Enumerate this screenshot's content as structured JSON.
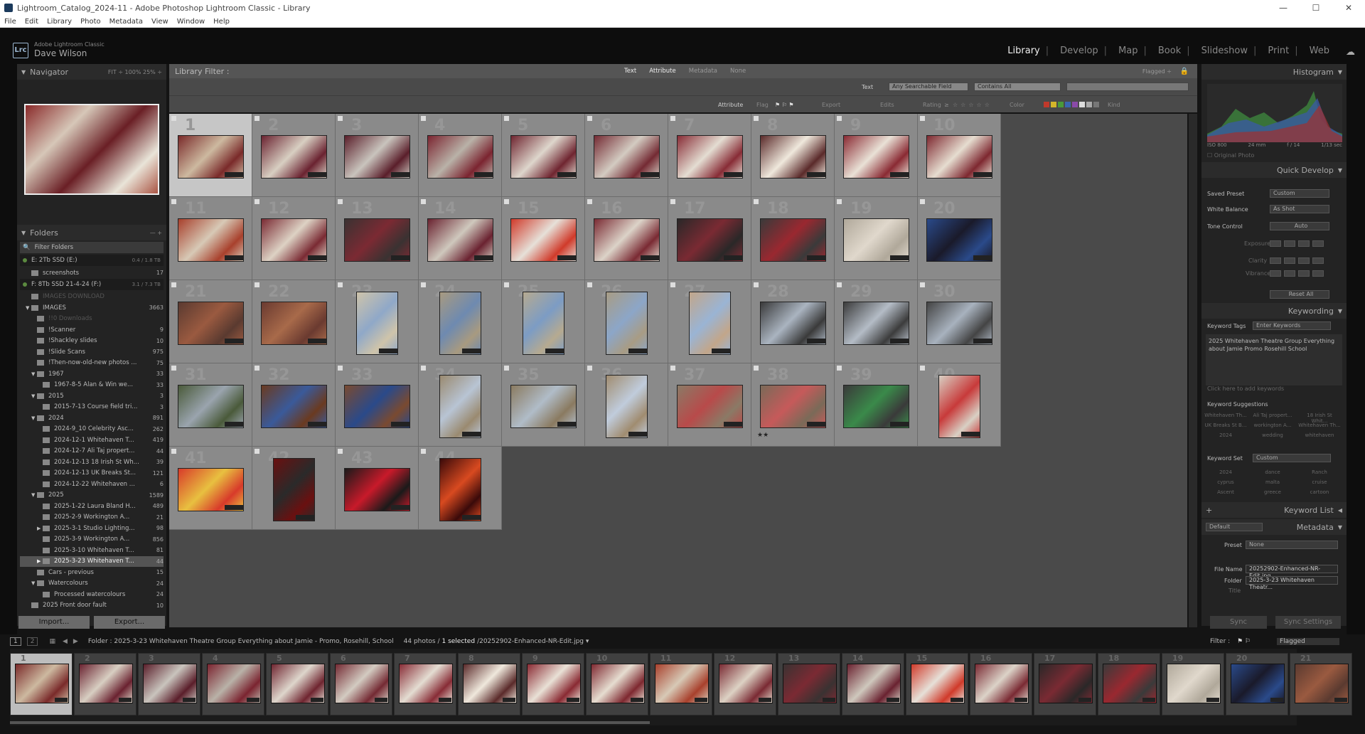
{
  "window": {
    "title": "Lightroom_Catalog_2024-11 - Adobe Photoshop Lightroom Classic - Library",
    "minimize": "—",
    "maximize": "☐",
    "close": "✕"
  },
  "menu": [
    "File",
    "Edit",
    "Library",
    "Photo",
    "Metadata",
    "View",
    "Window",
    "Help"
  ],
  "identity": {
    "logo": "Lrc",
    "product": "Adobe Lightroom Classic",
    "user": "Dave Wilson"
  },
  "modules": [
    "Library",
    "Develop",
    "Map",
    "Book",
    "Slideshow",
    "Print",
    "Web"
  ],
  "active_module": "Library",
  "navigator": {
    "title": "Navigator",
    "zoom": "FIT ÷   100%   25% ÷"
  },
  "folders": {
    "title": "Folders",
    "filter_placeholder": "Filter Folders",
    "drives": [
      {
        "name": "E: 2Tb SSD (E:)",
        "size": "0.4 / 1.8 TB"
      },
      {
        "name": "F: 8Tb SSD 21-4-24 (F:)",
        "size": "3.1 / 7.3 TB"
      }
    ],
    "items": [
      {
        "name": "screenshots",
        "count": "17",
        "indent": 1
      },
      {
        "name": "IMAGES DOWNLOAD",
        "count": "",
        "indent": 1,
        "dim": true
      },
      {
        "name": "IMAGES",
        "count": "3663",
        "indent": 1,
        "tri": "▼"
      },
      {
        "name": "!!0 Downloads",
        "count": "",
        "indent": 2,
        "dim": true
      },
      {
        "name": "!Scanner",
        "count": "9",
        "indent": 2
      },
      {
        "name": "!Shackley slides",
        "count": "10",
        "indent": 2
      },
      {
        "name": "!Slide Scans",
        "count": "975",
        "indent": 2
      },
      {
        "name": "!Then-now-old-new photos ...",
        "count": "75",
        "indent": 2
      },
      {
        "name": "1967",
        "count": "33",
        "indent": 2,
        "tri": "▼"
      },
      {
        "name": "1967-8-5 Alan & Win we...",
        "count": "33",
        "indent": 3
      },
      {
        "name": "2015",
        "count": "3",
        "indent": 2,
        "tri": "▼"
      },
      {
        "name": "2015-7-13 Course field tri...",
        "count": "3",
        "indent": 3
      },
      {
        "name": "2024",
        "count": "891",
        "indent": 2,
        "tri": "▼"
      },
      {
        "name": "2024-9_10 Celebrity Asc...",
        "count": "262",
        "indent": 3
      },
      {
        "name": "2024-12-1 Whitehaven T...",
        "count": "419",
        "indent": 3
      },
      {
        "name": "2024-12-7 Ali Taj propert...",
        "count": "44",
        "indent": 3
      },
      {
        "name": "2024-12-13 18 Irish St Wh...",
        "count": "39",
        "indent": 3
      },
      {
        "name": "2024-12-13 UK Breaks St...",
        "count": "121",
        "indent": 3
      },
      {
        "name": "2024-12-22 Whitehaven ...",
        "count": "6",
        "indent": 3
      },
      {
        "name": "2025",
        "count": "1589",
        "indent": 2,
        "tri": "▼"
      },
      {
        "name": "2025-1-22 Laura Bland H...",
        "count": "489",
        "indent": 3
      },
      {
        "name": "2025-2-9 Workington A...",
        "count": "21",
        "indent": 3
      },
      {
        "name": "2025-3-1 Studio Lighting...",
        "count": "98",
        "indent": 3,
        "tri": "▶"
      },
      {
        "name": "2025-3-9 Workington A...",
        "count": "856",
        "indent": 3
      },
      {
        "name": "2025-3-10 Whitehaven T...",
        "count": "81",
        "indent": 3
      },
      {
        "name": "2025-3-23 Whitehaven T...",
        "count": "44",
        "indent": 3,
        "tri": "▶",
        "sel": true
      },
      {
        "name": "Cars - previous",
        "count": "15",
        "indent": 2
      },
      {
        "name": "Watercolours",
        "count": "24",
        "indent": 2,
        "tri": "▼"
      },
      {
        "name": "Processed watercolours",
        "count": "24",
        "indent": 3
      },
      {
        "name": "2025 Front door fault",
        "count": "10",
        "indent": 1
      }
    ],
    "import": "Import...",
    "export": "Export..."
  },
  "library_filter": {
    "title": "Library Filter :",
    "tabs": [
      "Text",
      "Attribute",
      "Metadata",
      "None"
    ],
    "flagged": "Flagged ÷"
  },
  "text_bar": {
    "label": "Text",
    "field": "Any Searchable Field",
    "rule": "Contains All"
  },
  "attr_bar": {
    "label": "Attribute",
    "flag": "Flag",
    "export": "Export",
    "edits": "Edits",
    "rating": "Rating",
    "rating_op": "≥",
    "stars": "☆☆☆☆☆",
    "color": "Color",
    "kind": "Kind"
  },
  "label_colors": [
    "#c0392b",
    "#d4b62a",
    "#4a9a3a",
    "#3a66b0",
    "#8a4aa8",
    "#dddddd",
    "#aaaaaa",
    "#777777"
  ],
  "grid": {
    "cells": [
      {
        "n": "1",
        "w": 95,
        "h": 63,
        "c1": "#7a2a2a",
        "c2": "#cdb9a0",
        "sel": true
      },
      {
        "n": "2",
        "w": 95,
        "h": 63,
        "c1": "#6a2230",
        "c2": "#d8cfc2"
      },
      {
        "n": "3",
        "w": 95,
        "h": 63,
        "c1": "#5a1e2a",
        "c2": "#c9c4bd"
      },
      {
        "n": "4",
        "w": 95,
        "h": 63,
        "c1": "#7b2430",
        "c2": "#b9b2a8"
      },
      {
        "n": "5",
        "w": 95,
        "h": 63,
        "c1": "#6f2530",
        "c2": "#ded6cc"
      },
      {
        "n": "6",
        "w": 95,
        "h": 63,
        "c1": "#742a33",
        "c2": "#d3cbc1"
      },
      {
        "n": "7",
        "w": 95,
        "h": 63,
        "c1": "#882c36",
        "c2": "#e4ddd2"
      },
      {
        "n": "8",
        "w": 95,
        "h": 63,
        "c1": "#5a2a2a",
        "c2": "#efe8dc"
      },
      {
        "n": "9",
        "w": 95,
        "h": 63,
        "c1": "#8a2a33",
        "c2": "#e9e1d6"
      },
      {
        "n": "10",
        "w": 95,
        "h": 63,
        "c1": "#7e2830",
        "c2": "#e6ddd0"
      },
      {
        "n": "11",
        "w": 95,
        "h": 63,
        "c1": "#a8402c",
        "c2": "#d7c9b6"
      },
      {
        "n": "12",
        "w": 95,
        "h": 63,
        "c1": "#7a2a33",
        "c2": "#ddd2c4"
      },
      {
        "n": "13",
        "w": 95,
        "h": 63,
        "c1": "#3a3232",
        "c2": "#7b2a33"
      },
      {
        "n": "14",
        "w": 95,
        "h": 63,
        "c1": "#6a2230",
        "c2": "#cfc8bd"
      },
      {
        "n": "15",
        "w": 95,
        "h": 63,
        "c1": "#d03a2a",
        "c2": "#e6e0d8"
      },
      {
        "n": "16",
        "w": 95,
        "h": 63,
        "c1": "#7a2a33",
        "c2": "#dcd3c8"
      },
      {
        "n": "17",
        "w": 95,
        "h": 63,
        "c1": "#2a2828",
        "c2": "#7a2a33"
      },
      {
        "n": "18",
        "w": 95,
        "h": 63,
        "c1": "#3a3a3a",
        "c2": "#9a2830"
      },
      {
        "n": "19",
        "w": 95,
        "h": 63,
        "c1": "#b0a89a",
        "c2": "#e0d8cc"
      },
      {
        "n": "20",
        "w": 95,
        "h": 63,
        "c1": "#2a4a8a",
        "c2": "#1a1a2a"
      },
      {
        "n": "21",
        "w": 95,
        "h": 63,
        "c1": "#5a3a30",
        "c2": "#9a5a40"
      },
      {
        "n": "22",
        "w": 95,
        "h": 63,
        "c1": "#6a3a30",
        "c2": "#a86a4a"
      },
      {
        "n": "23",
        "w": 60,
        "h": 90,
        "c1": "#cfc4aa",
        "c2": "#8fa8c8"
      },
      {
        "n": "24",
        "w": 60,
        "h": 90,
        "c1": "#a89a80",
        "c2": "#6e8ab0"
      },
      {
        "n": "25",
        "w": 60,
        "h": 90,
        "c1": "#b6aa90",
        "c2": "#7c9cc4"
      },
      {
        "n": "26",
        "w": 60,
        "h": 90,
        "c1": "#a89c84",
        "c2": "#8ca6c8"
      },
      {
        "n": "27",
        "w": 60,
        "h": 90,
        "c1": "#c2a68a",
        "c2": "#9ab4d4"
      },
      {
        "n": "28",
        "w": 95,
        "h": 63,
        "c1": "#3a3a3a",
        "c2": "#aab4c0"
      },
      {
        "n": "29",
        "w": 95,
        "h": 63,
        "c1": "#3c3c3c",
        "c2": "#b4bcc6"
      },
      {
        "n": "30",
        "w": 95,
        "h": 63,
        "c1": "#444",
        "c2": "#a8b2be"
      },
      {
        "n": "31",
        "w": 95,
        "h": 63,
        "c1": "#4a5a3a",
        "c2": "#9aa4ae"
      },
      {
        "n": "32",
        "w": 95,
        "h": 63,
        "c1": "#6a3a20",
        "c2": "#3a5a9a"
      },
      {
        "n": "33",
        "w": 95,
        "h": 63,
        "c1": "#7a4a30",
        "c2": "#2a4a8a"
      },
      {
        "n": "34",
        "w": 60,
        "h": 90,
        "c1": "#9a8a70",
        "c2": "#b8c4d4"
      },
      {
        "n": "35",
        "w": 95,
        "h": 63,
        "c1": "#8a7a60",
        "c2": "#b0bcc8"
      },
      {
        "n": "36",
        "w": 60,
        "h": 90,
        "c1": "#a08c70",
        "c2": "#c0ccdc"
      },
      {
        "n": "37",
        "w": 95,
        "h": 63,
        "c1": "#8a7a66",
        "c2": "#b84a4a"
      },
      {
        "n": "38",
        "w": 95,
        "h": 63,
        "c1": "#7a6a58",
        "c2": "#c65a5a",
        "stars": "★★"
      },
      {
        "n": "39",
        "w": 95,
        "h": 63,
        "c1": "#3a3a3a",
        "c2": "#3a8a4a"
      },
      {
        "n": "40",
        "w": 60,
        "h": 90,
        "c1": "#d8d0c4",
        "c2": "#c83a3a"
      },
      {
        "n": "41",
        "w": 95,
        "h": 63,
        "c1": "#d83a2a",
        "c2": "#e8c040"
      },
      {
        "n": "42",
        "w": 60,
        "h": 90,
        "c1": "#6a1010",
        "c2": "#2a2a2a"
      },
      {
        "n": "43",
        "w": 95,
        "h": 63,
        "c1": "#1a1a1a",
        "c2": "#c81a2a"
      },
      {
        "n": "44",
        "w": 60,
        "h": 90,
        "c1": "#3a0a0a",
        "c2": "#d84a20"
      }
    ]
  },
  "histogram": {
    "title": "Histogram",
    "iso": "ISO 800",
    "focal": "24 mm",
    "aperture": "f / 14",
    "shutter": "1/13 sec",
    "original": "Original Photo"
  },
  "quick_develop": {
    "title": "Quick Develop",
    "saved_preset": "Saved Preset",
    "saved_preset_val": "Custom",
    "white_balance": "White Balance",
    "wb_val": "As Shot",
    "tone": "Tone Control",
    "auto": "Auto",
    "exposure": "Exposure",
    "clarity": "Clarity",
    "vibrance": "Vibrance",
    "reset": "Reset All"
  },
  "keywording": {
    "title": "Keywording",
    "tags": "Keyword Tags",
    "tags_val": "Enter Keywords",
    "text": "2025 Whitehaven Theatre Group Everything about Jamie Promo Rosehill School",
    "add": "Click here to add keywords",
    "suggestions": "Keyword Suggestions",
    "sugg": [
      "Whitehaven Th...",
      "Ali Taj propert...",
      "18 Irish St Whit...",
      "UK Breaks St B...",
      "workington A...",
      "Whitehaven Th...",
      "2024",
      "wedding",
      "whitehaven"
    ],
    "set": "Keyword Set",
    "set_val": "Custom",
    "set_words": [
      "2024",
      "dance",
      "Ranch",
      "cyprus",
      "malta",
      "cruise",
      "Ascent",
      "greece",
      "cartoon"
    ]
  },
  "keyword_list": {
    "title": "Keyword List"
  },
  "metadata": {
    "title": "Metadata",
    "default": "Default",
    "preset": "Preset",
    "preset_val": "None",
    "file_name_lbl": "File Name",
    "file_name": "20252902-Enhanced-NR-Edit.jpg",
    "folder_lbl": "Folder",
    "folder": "2025-3-23 Whitehaven Theatr...",
    "title_lbl": "Title"
  },
  "sync": {
    "sync": "Sync",
    "settings": "Sync Settings"
  },
  "status": {
    "view1": "1",
    "view2": "2",
    "path": "Folder : 2025-3-23 Whitehaven Theatre Group Everything about Jamie - Promo, Rosehill, School",
    "count": "44 photos /",
    "selected": "1 selected",
    "file": "/20252902-Enhanced-NR-Edit.jpg ▾",
    "filter": "Filter :",
    "filter_val": "Flagged"
  },
  "filmstrip": [
    {
      "n": "1",
      "c1": "#7a2a2a",
      "c2": "#cdb9a0",
      "sel": true
    },
    {
      "n": "2",
      "c1": "#6a2230",
      "c2": "#d8cfc2"
    },
    {
      "n": "3",
      "c1": "#5a1e2a",
      "c2": "#c9c4bd"
    },
    {
      "n": "4",
      "c1": "#7b2430",
      "c2": "#b9b2a8"
    },
    {
      "n": "5",
      "c1": "#6f2530",
      "c2": "#ded6cc"
    },
    {
      "n": "6",
      "c1": "#742a33",
      "c2": "#d3cbc1"
    },
    {
      "n": "7",
      "c1": "#882c36",
      "c2": "#e4ddd2"
    },
    {
      "n": "8",
      "c1": "#5a2a2a",
      "c2": "#efe8dc"
    },
    {
      "n": "9",
      "c1": "#8a2a33",
      "c2": "#e9e1d6"
    },
    {
      "n": "10",
      "c1": "#7e2830",
      "c2": "#e6ddd0"
    },
    {
      "n": "11",
      "c1": "#a8402c",
      "c2": "#d7c9b6"
    },
    {
      "n": "12",
      "c1": "#7a2a33",
      "c2": "#ddd2c4"
    },
    {
      "n": "13",
      "c1": "#3a3232",
      "c2": "#7b2a33"
    },
    {
      "n": "14",
      "c1": "#6a2230",
      "c2": "#cfc8bd"
    },
    {
      "n": "15",
      "c1": "#d03a2a",
      "c2": "#e6e0d8"
    },
    {
      "n": "16",
      "c1": "#7a2a33",
      "c2": "#dcd3c8"
    },
    {
      "n": "17",
      "c1": "#2a2828",
      "c2": "#7a2a33"
    },
    {
      "n": "18",
      "c1": "#3a3a3a",
      "c2": "#9a2830"
    },
    {
      "n": "19",
      "c1": "#b0a89a",
      "c2": "#e0d8cc"
    },
    {
      "n": "20",
      "c1": "#2a4a8a",
      "c2": "#1a1a2a"
    },
    {
      "n": "21",
      "c1": "#5a3a30",
      "c2": "#9a5a40"
    }
  ]
}
